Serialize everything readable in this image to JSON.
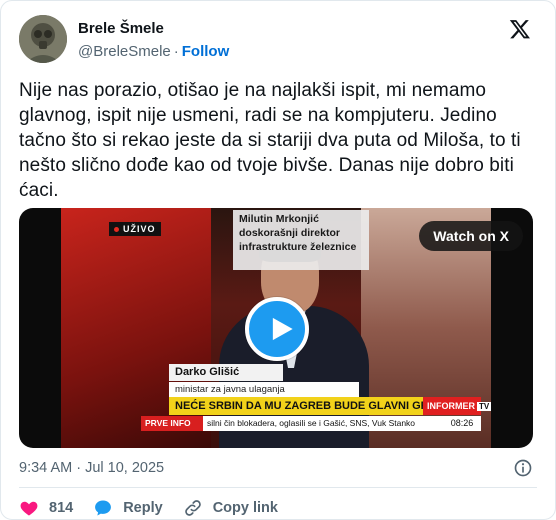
{
  "tweet": {
    "author_name": "Brele Šmele",
    "handle": "@BreleSmele",
    "separator": "·",
    "follow_label": "Follow",
    "text": "Nije nas porazio, otišao je na najlakši ispit, mi nemamo glavnog, ispit nije usmeni, radi se na kompjuteru. Jedino tačno što si rekao jeste da si stariji dva puta od Miloša, to ti nešto slično dođe kao od tvoje bivše. Danas nije dobro biti ćaci.",
    "timestamp": "9:34 AM · Jul 10, 2025"
  },
  "media": {
    "watch_label": "Watch on X",
    "live_badge": "UŽIVO",
    "top_caption": "Milutin Mrkonjić doskorašnji direktor infrastrukture železnice",
    "speaker_name": "Darko Glišić",
    "speaker_role": "ministar za javna ulaganja",
    "headline": "NEĆE SRBIN DA MU ZAGREB BUDE GLAVNI GRAD!",
    "channel": "INFORMER",
    "channel_tv": "TV",
    "ticker_label": "PRVE INFO",
    "ticker_text": "silni čin blokadera, oglasili se i Gašić, SNS, Vuk Stanko",
    "clock": "08:26"
  },
  "actions": {
    "like_count": "814",
    "reply_label": "Reply",
    "copy_label": "Copy link"
  },
  "colors": {
    "like": "#f91880",
    "reply": "#1d9bf0",
    "accent": "#006fd6",
    "play": "#1d9bf0"
  },
  "icons": [
    "x-logo-icon",
    "play-icon",
    "info-icon",
    "heart-icon",
    "reply-bubble-icon",
    "link-icon"
  ]
}
